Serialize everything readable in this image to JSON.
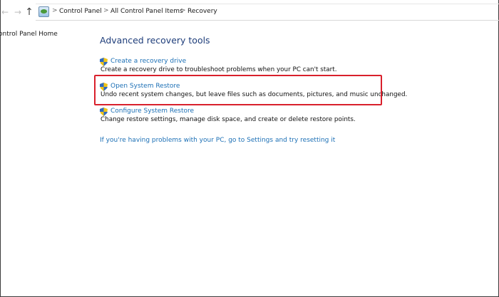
{
  "address_bar": {
    "breadcrumbs": [
      "Control Panel",
      "All Control Panel Items",
      "Recovery"
    ],
    "separator": ">"
  },
  "left_pane": {
    "home_link": "ontrol Panel Home"
  },
  "main": {
    "title": "Advanced recovery tools",
    "tools": [
      {
        "label": "Create a recovery drive",
        "description": "Create a recovery drive to troubleshoot problems when your PC can't start.",
        "icon": "uac-shield-icon"
      },
      {
        "label": "Open System Restore",
        "description": "Undo recent system changes, but leave files such as documents, pictures, and music unchanged.",
        "icon": "uac-shield-icon"
      },
      {
        "label": "Configure System Restore",
        "description": "Change restore settings, manage disk space, and create or delete restore points.",
        "icon": "uac-shield-icon"
      }
    ],
    "reset_link": "If you're having problems with your PC, go to Settings and try resetting it"
  },
  "colors": {
    "link": "#1b6fb5",
    "title": "#1e3d7a",
    "highlight": "#d9202c"
  }
}
